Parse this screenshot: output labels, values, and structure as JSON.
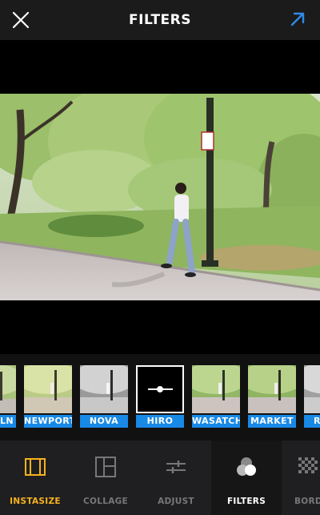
{
  "header": {
    "title": "FILTERS"
  },
  "filters": [
    {
      "label": "LN",
      "style": "warm"
    },
    {
      "label": "NEWPORT",
      "style": "warm"
    },
    {
      "label": "NOVA",
      "style": "bw"
    },
    {
      "label": "HIRO",
      "style": "active",
      "selected": true
    },
    {
      "label": "WASATCH",
      "style": "normal"
    },
    {
      "label": "MARKET",
      "style": "normal"
    },
    {
      "label": "R",
      "style": "bw"
    }
  ],
  "tabs": [
    {
      "label": "INSTASIZE",
      "icon": "instasize-frame-icon"
    },
    {
      "label": "COLLAGE",
      "icon": "collage-grid-icon"
    },
    {
      "label": "ADJUST",
      "icon": "sliders-icon"
    },
    {
      "label": "FILTERS",
      "icon": "filters-circles-icon",
      "active": true
    },
    {
      "label": "BORD",
      "icon": "border-pattern-icon"
    }
  ],
  "colors": {
    "filter_label_bg": "#1989e6",
    "instasize_accent": "#f6b21d",
    "share_arrow": "#2f8be8"
  }
}
